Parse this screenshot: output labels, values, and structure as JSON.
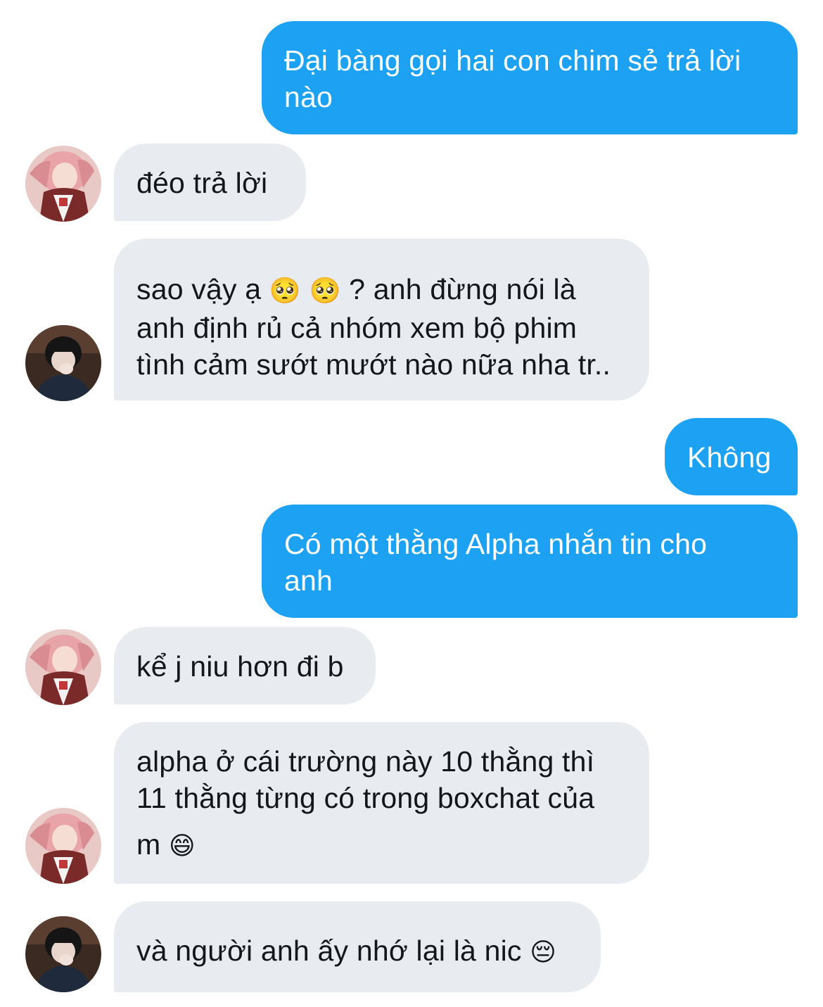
{
  "messages": [
    {
      "sender": "me",
      "lines": [
        "Đại bàng gọi hai con chim sẻ trả lời",
        "nào"
      ]
    },
    {
      "sender": "anime-girl",
      "lines": [
        "đéo trả lời"
      ]
    },
    {
      "sender": "masked-guy",
      "lines": [
        "sao vậy ạ",
        "? anh đừng nói là",
        "anh định rủ cả nhóm xem bộ phim",
        "tình cảm sướt mướt nào nữa nha tr.."
      ],
      "emoji": "🥺"
    },
    {
      "sender": "me",
      "lines": [
        "Không"
      ]
    },
    {
      "sender": "me",
      "lines": [
        "Có một thằng Alpha nhắn tin cho",
        "anh"
      ]
    },
    {
      "sender": "anime-girl",
      "lines": [
        "kể j niu hơn đi b"
      ]
    },
    {
      "sender": "anime-girl",
      "lines": [
        "alpha ở cái trường này 10 thằng thì",
        "11 thằng từng có trong boxchat của",
        "m"
      ],
      "emoji": "😄"
    },
    {
      "sender": "masked-guy",
      "lines": [
        "và người anh ấy nhớ lại là nic"
      ],
      "emoji": "😔"
    }
  ],
  "colors": {
    "outgoing_bubble": "#1da1f2",
    "incoming_bubble": "#e8ecf0",
    "text_dark": "#14171a"
  }
}
